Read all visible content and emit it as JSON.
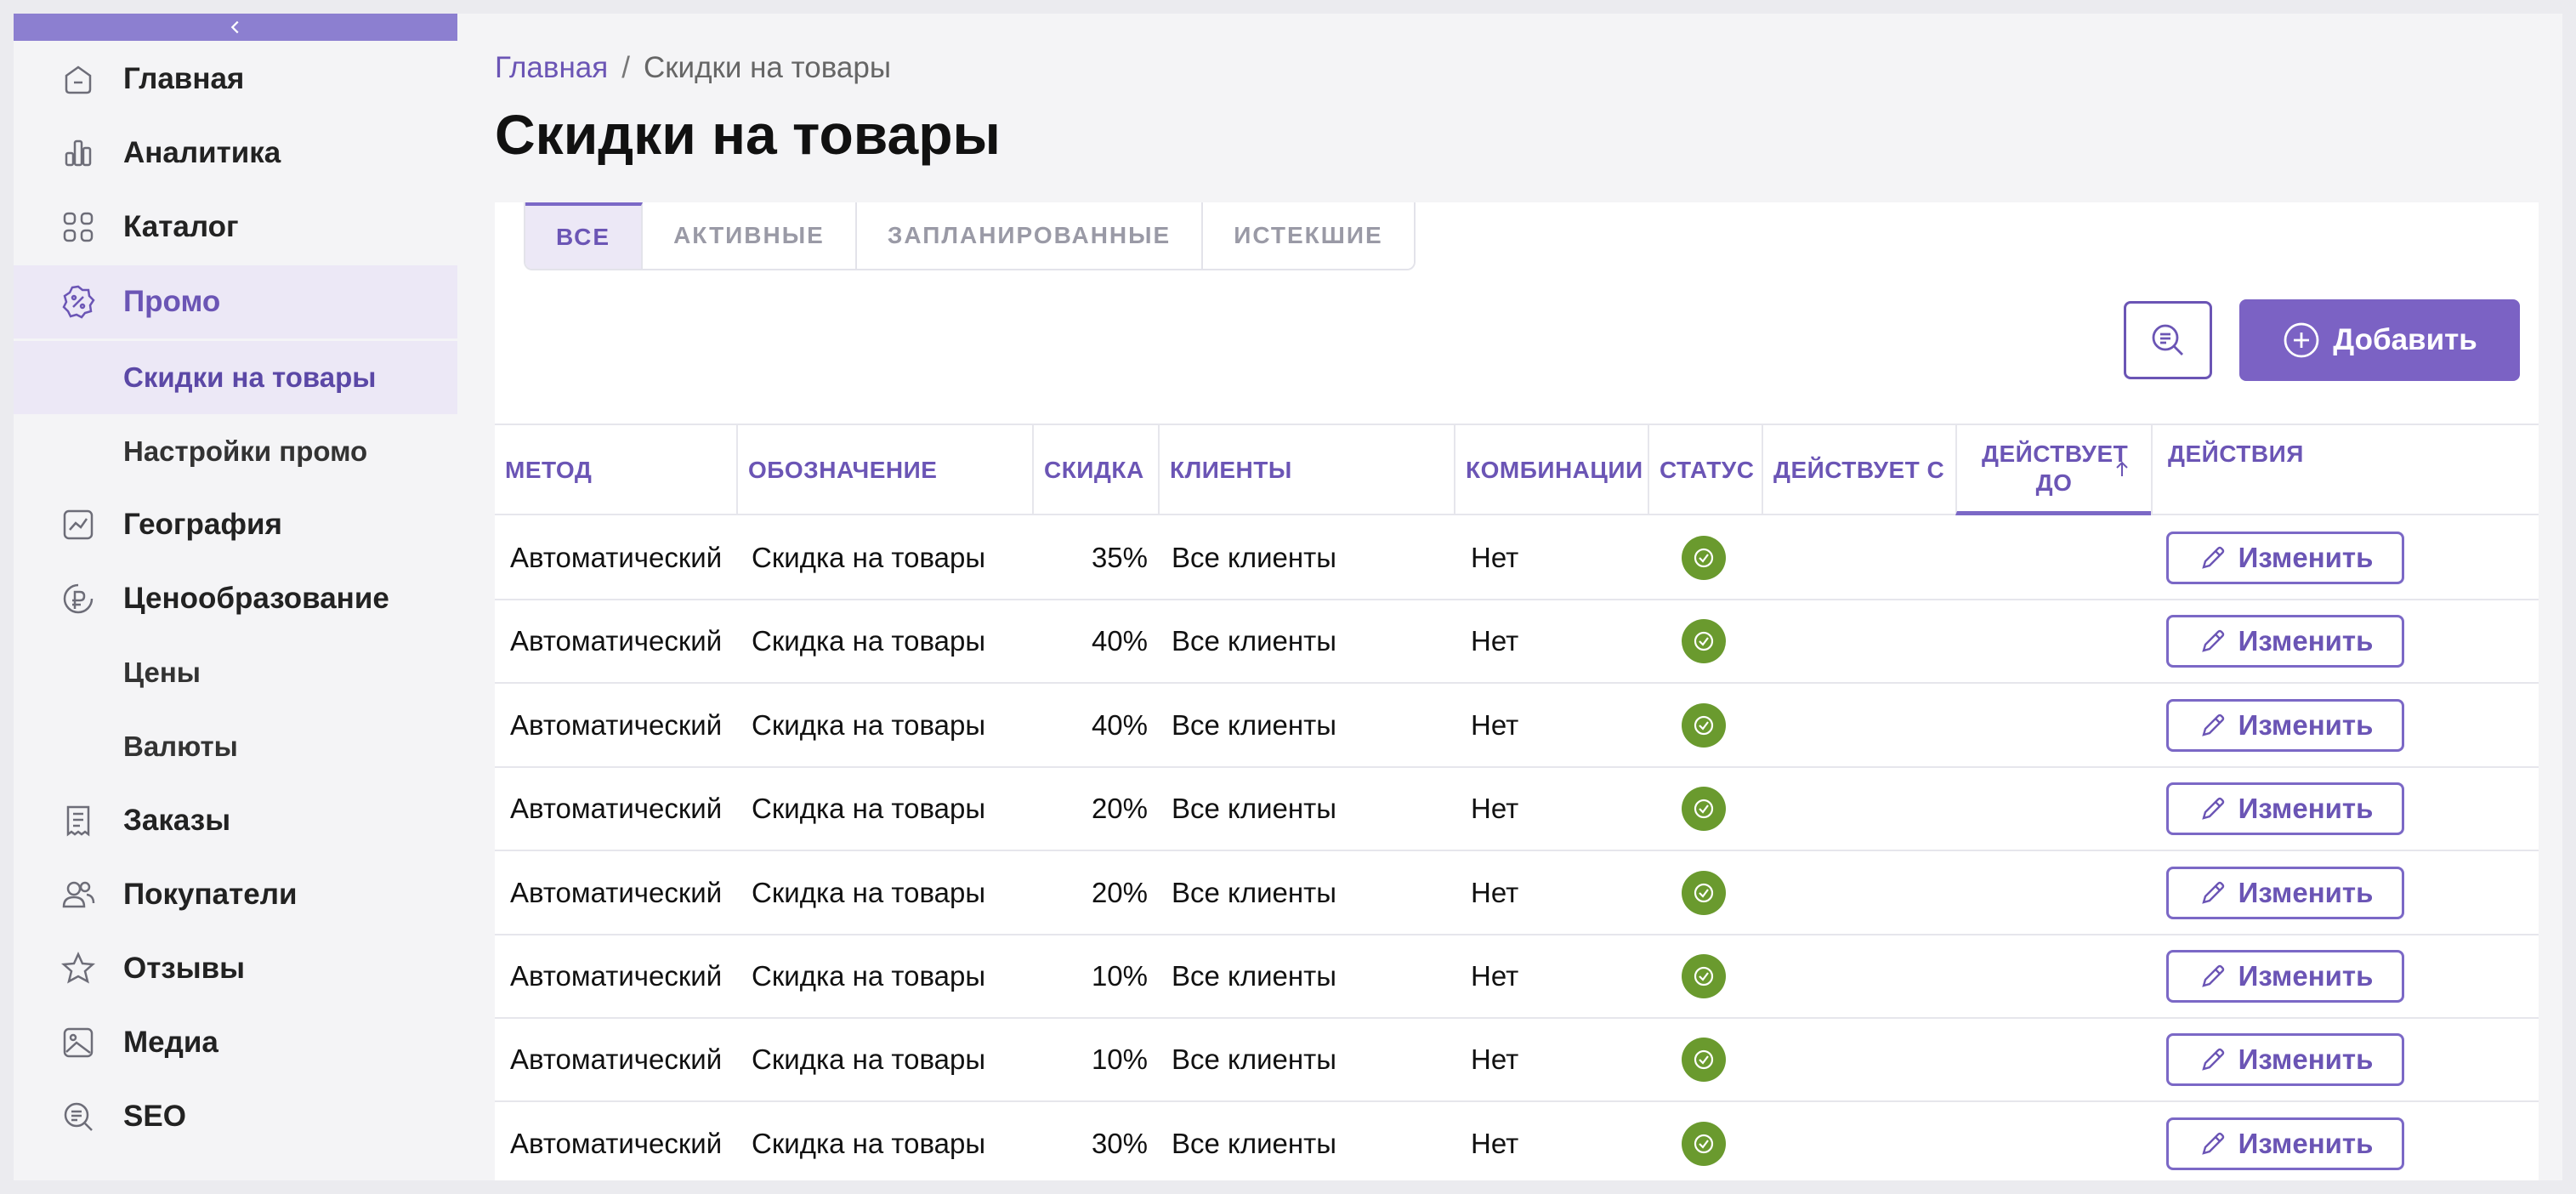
{
  "sidebar": {
    "items": [
      {
        "label": "Главная",
        "icon": "home-icon"
      },
      {
        "label": "Аналитика",
        "icon": "chart-icon"
      },
      {
        "label": "Каталог",
        "icon": "grid-icon"
      },
      {
        "label": "Промо",
        "icon": "percent-badge-icon"
      },
      {
        "label": "География",
        "icon": "trend-icon"
      },
      {
        "label": "Ценообразование",
        "icon": "ruble-icon"
      },
      {
        "label": "Заказы",
        "icon": "order-list-icon"
      },
      {
        "label": "Покупатели",
        "icon": "users-icon"
      },
      {
        "label": "Отзывы",
        "icon": "star-icon"
      },
      {
        "label": "Медиа",
        "icon": "image-icon"
      },
      {
        "label": "SEO",
        "icon": "seo-search-icon"
      }
    ],
    "promo_sub": [
      "Скидки на товары",
      "Настройки промо"
    ],
    "pricing_sub": [
      "Цены",
      "Валюты"
    ]
  },
  "breadcrumb": {
    "home": "Главная",
    "separator": "/",
    "current": "Скидки на товары"
  },
  "page_title": "Скидки на товары",
  "tabs": [
    "ВСЕ",
    "АКТИВНЫЕ",
    "ЗАПЛАНИРОВАННЫЕ",
    "ИСТЕКШИЕ"
  ],
  "toolbar": {
    "add_label": "Добавить"
  },
  "table": {
    "headers": [
      "МЕТОД",
      "ОБОЗНАЧЕНИЕ",
      "СКИДКА",
      "КЛИЕНТЫ",
      "КОМБИНАЦИИ",
      "СТАТУС",
      "ДЕЙСТВУЕТ С",
      "ДЕЙСТВУЕТ ДО",
      "ДЕЙСТВИЯ"
    ],
    "edit_label": "Изменить",
    "rows": [
      {
        "method": "Автоматический",
        "title": "Скидка на товары",
        "discount": "35%",
        "clients": "Все клиенты",
        "combinations": "Нет",
        "from": "",
        "to": ""
      },
      {
        "method": "Автоматический",
        "title": "Скидка на товары",
        "discount": "40%",
        "clients": "Все клиенты",
        "combinations": "Нет",
        "from": "",
        "to": ""
      },
      {
        "method": "Автоматический",
        "title": "Скидка на товары",
        "discount": "40%",
        "clients": "Все клиенты",
        "combinations": "Нет",
        "from": "",
        "to": ""
      },
      {
        "method": "Автоматический",
        "title": "Скидка на товары",
        "discount": "20%",
        "clients": "Все клиенты",
        "combinations": "Нет",
        "from": "",
        "to": ""
      },
      {
        "method": "Автоматический",
        "title": "Скидка на товары",
        "discount": "20%",
        "clients": "Все клиенты",
        "combinations": "Нет",
        "from": "",
        "to": ""
      },
      {
        "method": "Автоматический",
        "title": "Скидка на товары",
        "discount": "10%",
        "clients": "Все клиенты",
        "combinations": "Нет",
        "from": "",
        "to": ""
      },
      {
        "method": "Автоматический",
        "title": "Скидка на товары",
        "discount": "10%",
        "clients": "Все клиенты",
        "combinations": "Нет",
        "from": "",
        "to": ""
      },
      {
        "method": "Автоматический",
        "title": "Скидка на товары",
        "discount": "30%",
        "clients": "Все клиенты",
        "combinations": "Нет",
        "from": "",
        "to": ""
      }
    ]
  },
  "colors": {
    "accent": "#7b62c4",
    "status_active": "#6a9a2e"
  }
}
